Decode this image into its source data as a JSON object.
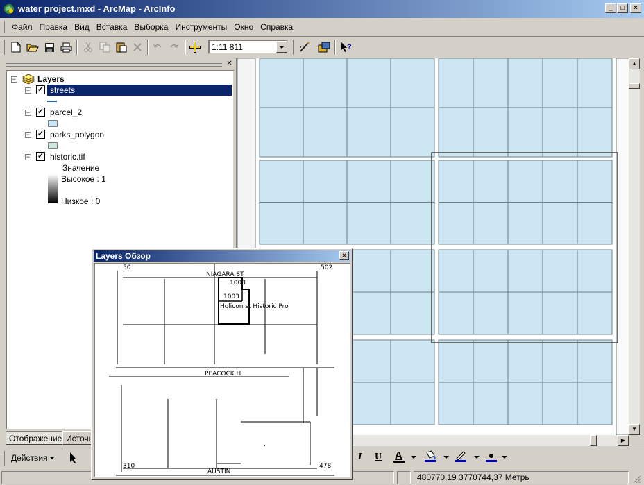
{
  "window": {
    "title": "water project.mxd - ArcMap - ArcInfo",
    "buttons": {
      "minimize": "_",
      "maximize": "□",
      "close": "×"
    }
  },
  "menu": [
    "Файл",
    "Правка",
    "Вид",
    "Вставка",
    "Выборка",
    "Инструменты",
    "Окно",
    "Справка"
  ],
  "toolbar": {
    "scale": "1:11 811",
    "icons": [
      "new-document-icon",
      "open-folder-icon",
      "save-icon",
      "print-icon",
      "cut-icon",
      "copy-icon",
      "paste-icon",
      "delete-icon",
      "undo-icon",
      "redo-icon",
      "add-data-icon",
      "editor-toolbar-icon",
      "arctoolbox-icon",
      "whats-this-icon"
    ]
  },
  "toc": {
    "root": "Layers",
    "layers": [
      {
        "name": "streets",
        "checked": true,
        "selected": true,
        "symbol": "line"
      },
      {
        "name": "parcel_2",
        "checked": true,
        "selected": false,
        "symbol": "fill",
        "color": "#c8e6f5"
      },
      {
        "name": "parks_polygon",
        "checked": true,
        "selected": false,
        "symbol": "fill",
        "color": "#cfe8de"
      },
      {
        "name": "historic.tif",
        "checked": true,
        "selected": false,
        "symbol": "raster"
      }
    ],
    "raster_legend": {
      "title": "Значение",
      "high": "Высокое : 1",
      "low": "Низкое : 0"
    },
    "tabs": [
      "Отображение",
      "Источн"
    ]
  },
  "overview": {
    "title": "Layers Обзор",
    "close": "×",
    "labels": [
      "50",
      "502",
      "310",
      "478",
      "PEACOCK H",
      "AUSTIN",
      "Holicon st Historic Pro",
      "NIAGARA ST",
      "1008",
      "1003"
    ]
  },
  "drawing_toolbar": {
    "actions_label": "Действия",
    "italic": "I",
    "underline": "U",
    "font_color": "A"
  },
  "statusbar": {
    "coordinates": "480770,19  3770744,37 Метрь"
  },
  "colors": {
    "parcel_fill": "#cce6f2",
    "parcel_line": "#6b7f8a",
    "selection": "#0a246a"
  }
}
